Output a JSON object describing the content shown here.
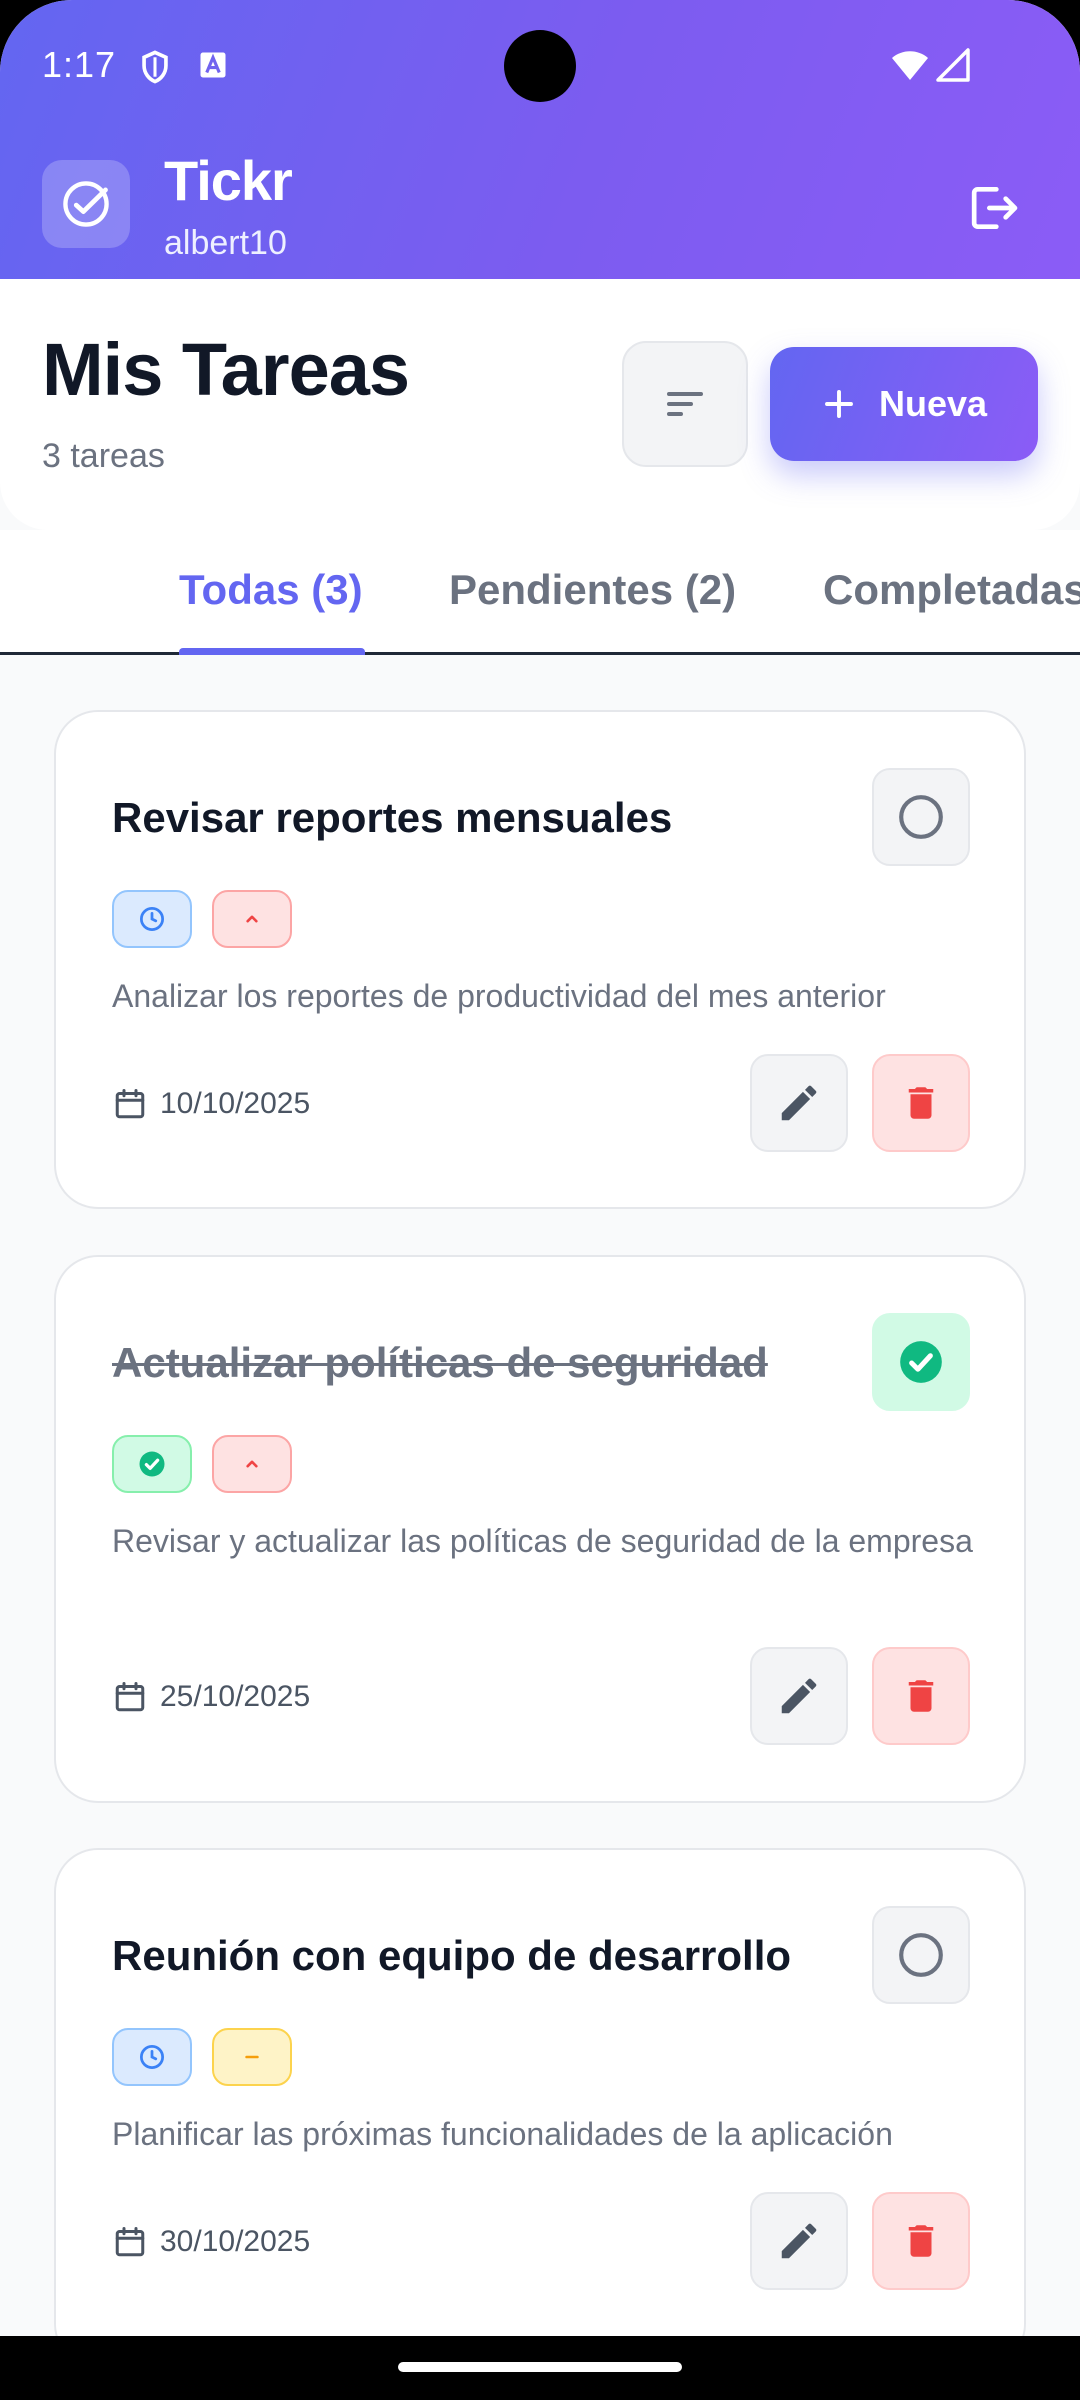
{
  "status_bar": {
    "time": "1:17"
  },
  "app": {
    "name": "Tickr",
    "user": "albert10"
  },
  "header": {
    "title": "Mis Tareas",
    "count": "3 tareas",
    "new_label": "Nueva"
  },
  "tabs": [
    {
      "label": "Todas (3)",
      "active": true
    },
    {
      "label": "Pendientes (2)",
      "active": false
    },
    {
      "label": "Completadas",
      "active": false
    }
  ],
  "tasks": [
    {
      "title": "Revisar reportes mensuales",
      "description": "Analizar los reportes de productividad del mes anterior",
      "date": "10/10/2025",
      "completed": false,
      "status_icon": "clock-icon",
      "priority_icon": "chevron-up-icon"
    },
    {
      "title": "Actualizar políticas de seguridad",
      "description": "Revisar y actualizar las políticas de seguridad de la empresa",
      "date": "25/10/2025",
      "completed": true,
      "status_icon": "check-circle-icon",
      "priority_icon": "chevron-up-icon"
    },
    {
      "title": "Reunión con equipo de desarrollo",
      "description": "Planificar las próximas funcionalidades de la aplicación",
      "date": "30/10/2025",
      "completed": false,
      "status_icon": "clock-icon",
      "priority_icon": "minus-icon"
    }
  ],
  "colors": {
    "accent": "#6366f1",
    "accent_end": "#8b5cf6",
    "danger": "#ef4444",
    "success": "#10b981",
    "warning": "#f59e0b"
  }
}
